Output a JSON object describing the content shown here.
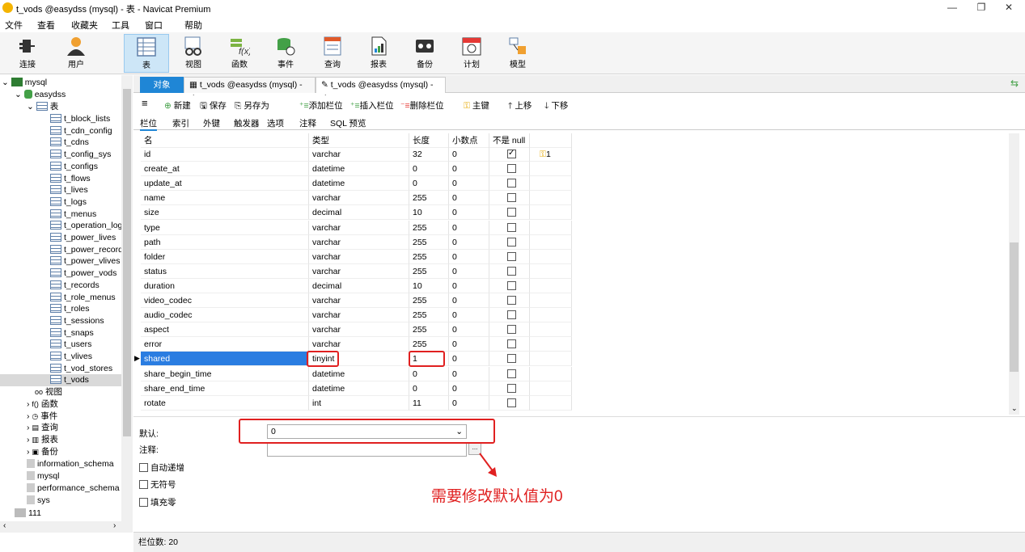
{
  "window": {
    "title": "t_vods @easydss (mysql) - 表 - Navicat Premium",
    "min": "—",
    "restore": "❐",
    "close": "✕"
  },
  "menu": [
    "文件",
    "查看",
    "收藏夹",
    "工具",
    "窗口",
    "帮助"
  ],
  "toolbar": [
    {
      "label": "连接",
      "icon": "plug-icon"
    },
    {
      "label": "用户",
      "icon": "user-icon"
    },
    {
      "label": "表",
      "icon": "table-icon",
      "active": true
    },
    {
      "label": "视图",
      "icon": "view-icon"
    },
    {
      "label": "函数",
      "icon": "function-icon"
    },
    {
      "label": "事件",
      "icon": "event-icon"
    },
    {
      "label": "查询",
      "icon": "query-icon"
    },
    {
      "label": "报表",
      "icon": "report-icon"
    },
    {
      "label": "备份",
      "icon": "backup-icon"
    },
    {
      "label": "计划",
      "icon": "schedule-icon"
    },
    {
      "label": "模型",
      "icon": "model-icon"
    }
  ],
  "tree": {
    "connection": "mysql",
    "database": "easydss",
    "tables_node": "表",
    "tables": [
      "t_block_lists",
      "t_cdn_config",
      "t_cdns",
      "t_config_sys",
      "t_configs",
      "t_flows",
      "t_lives",
      "t_logs",
      "t_menus",
      "t_operation_log",
      "t_power_lives",
      "t_power_record",
      "t_power_vlives",
      "t_power_vods",
      "t_records",
      "t_role_menus",
      "t_roles",
      "t_sessions",
      "t_snaps",
      "t_users",
      "t_vlives",
      "t_vod_stores",
      "t_vods"
    ],
    "selected_table": "t_vods",
    "other_nodes": [
      "视图",
      "函数",
      "事件",
      "查询",
      "报表",
      "备份"
    ],
    "databases": [
      "information_schema",
      "mysql",
      "performance_schema",
      "sys"
    ],
    "other_connection": "111"
  },
  "tabs": {
    "objects": "对象",
    "tab1": "t_vods @easydss (mysql) - 表",
    "tab2": "t_vods @easydss (mysql) - 表"
  },
  "edit_toolbar": {
    "menu": "≡",
    "new": "新建",
    "save": "保存",
    "save_as": "另存为",
    "add_field": "添加栏位",
    "insert_field": "插入栏位",
    "delete_field": "删除栏位",
    "primary_key": "主键",
    "move_up": "上移",
    "move_down": "下移"
  },
  "subtabs": [
    "栏位",
    "索引",
    "外键",
    "触发器",
    "选项",
    "注释",
    "SQL 预览"
  ],
  "grid": {
    "headers": [
      "名",
      "类型",
      "长度",
      "小数点",
      "不是 null",
      ""
    ],
    "rows": [
      {
        "name": "id",
        "type": "varchar",
        "len": "32",
        "dec": "0",
        "notnull": true,
        "key": "1"
      },
      {
        "name": "create_at",
        "type": "datetime",
        "len": "0",
        "dec": "0",
        "notnull": false
      },
      {
        "name": "update_at",
        "type": "datetime",
        "len": "0",
        "dec": "0",
        "notnull": false
      },
      {
        "name": "name",
        "type": "varchar",
        "len": "255",
        "dec": "0",
        "notnull": false
      },
      {
        "name": "size",
        "type": "decimal",
        "len": "10",
        "dec": "0",
        "notnull": false
      },
      {
        "name": "type",
        "type": "varchar",
        "len": "255",
        "dec": "0",
        "notnull": false
      },
      {
        "name": "path",
        "type": "varchar",
        "len": "255",
        "dec": "0",
        "notnull": false
      },
      {
        "name": "folder",
        "type": "varchar",
        "len": "255",
        "dec": "0",
        "notnull": false
      },
      {
        "name": "status",
        "type": "varchar",
        "len": "255",
        "dec": "0",
        "notnull": false
      },
      {
        "name": "duration",
        "type": "decimal",
        "len": "10",
        "dec": "0",
        "notnull": false
      },
      {
        "name": "video_codec",
        "type": "varchar",
        "len": "255",
        "dec": "0",
        "notnull": false
      },
      {
        "name": "audio_codec",
        "type": "varchar",
        "len": "255",
        "dec": "0",
        "notnull": false
      },
      {
        "name": "aspect",
        "type": "varchar",
        "len": "255",
        "dec": "0",
        "notnull": false
      },
      {
        "name": "error",
        "type": "varchar",
        "len": "255",
        "dec": "0",
        "notnull": false
      },
      {
        "name": "shared",
        "type": "tinyint",
        "len": "1",
        "dec": "0",
        "notnull": false,
        "selected": true
      },
      {
        "name": "share_begin_time",
        "type": "datetime",
        "len": "0",
        "dec": "0",
        "notnull": false
      },
      {
        "name": "share_end_time",
        "type": "datetime",
        "len": "0",
        "dec": "0",
        "notnull": false
      },
      {
        "name": "rotate",
        "type": "int",
        "len": "11",
        "dec": "0",
        "notnull": false
      }
    ]
  },
  "props": {
    "default_label": "默认:",
    "default_value": "0",
    "comment_label": "注释:",
    "comment_value": "",
    "ellipsis": "...",
    "auto_increment": "自动递增",
    "unsigned": "无符号",
    "zerofill": "填充零"
  },
  "annotation": "需要修改默认值为0",
  "status": {
    "field_count": "栏位数: 20"
  },
  "colors": {
    "accent": "#1f86d6",
    "selection": "#2a7de1",
    "annotation": "#e02020"
  }
}
